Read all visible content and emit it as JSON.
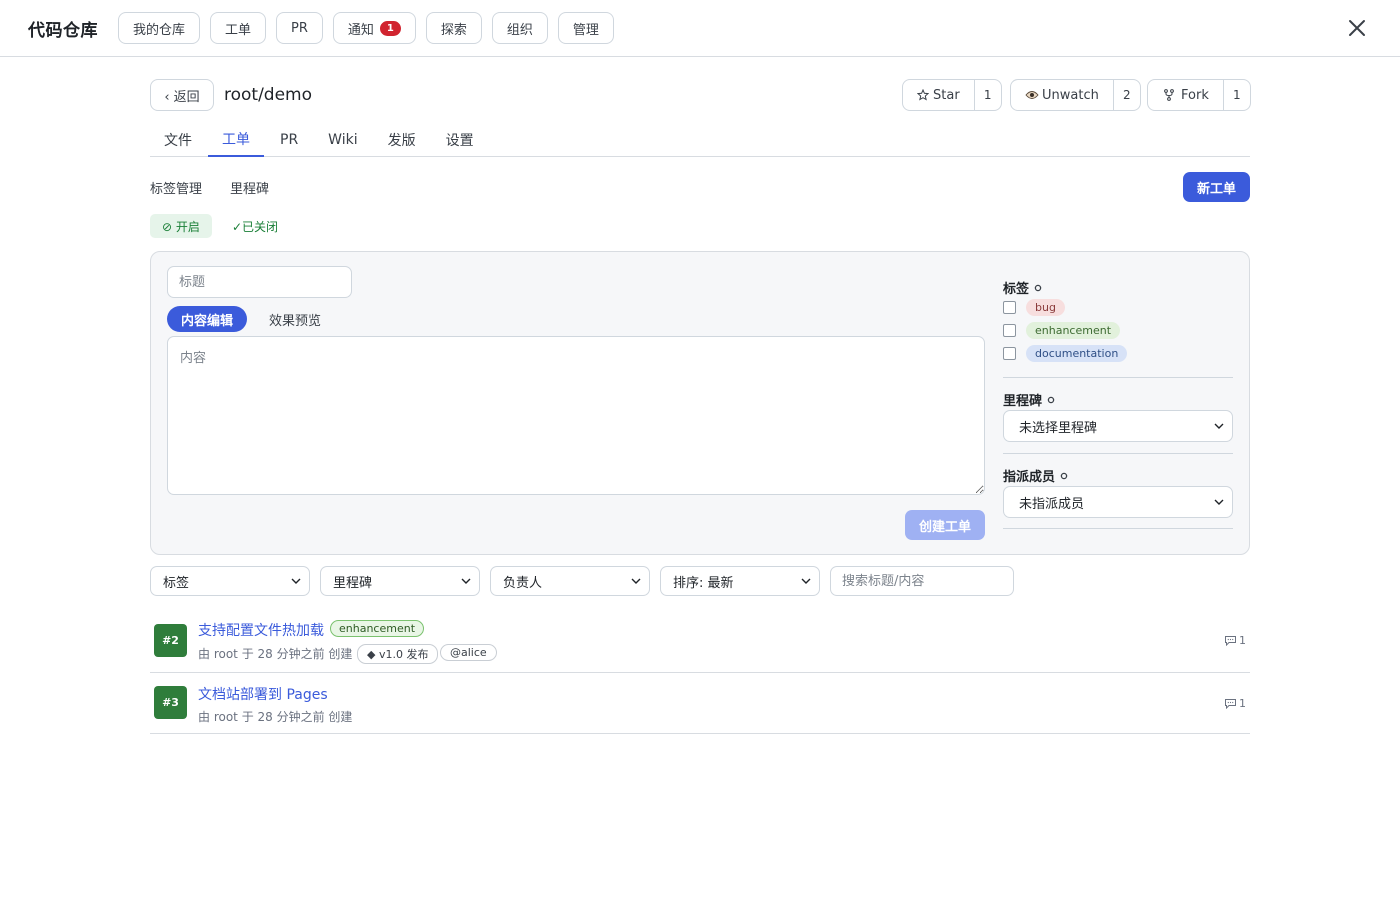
{
  "topbar": {
    "brand": "代码仓库",
    "nav": [
      {
        "label": "我的仓库"
      },
      {
        "label": "工单"
      },
      {
        "label": "PR"
      },
      {
        "label": "通知",
        "badge": "1"
      },
      {
        "label": "探索"
      },
      {
        "label": "组织"
      },
      {
        "label": "管理"
      }
    ],
    "close_icon": "close-icon"
  },
  "repo": {
    "back_label": "‹ 返回",
    "name": "root/demo",
    "star": {
      "label": "Star",
      "count": "1"
    },
    "watch": {
      "label": "Unwatch",
      "count": "2"
    },
    "fork": {
      "label": "Fork",
      "count": "1"
    }
  },
  "tabs": [
    {
      "label": "文件"
    },
    {
      "label": "工单",
      "active": true
    },
    {
      "label": "PR"
    },
    {
      "label": "Wiki"
    },
    {
      "label": "发版"
    },
    {
      "label": "设置"
    }
  ],
  "sublinks": {
    "labels": "标签管理",
    "milestones": "里程碑"
  },
  "new_issue_label": "新工单",
  "states": {
    "open": "⊘ 开启",
    "closed": "✓已关闭"
  },
  "form": {
    "title_placeholder": "标题",
    "edit_tab": "内容编辑",
    "preview_tab": "效果预览",
    "content_placeholder": "内容",
    "create_label": "创建工单",
    "labels_heading": "标签",
    "labels": [
      {
        "name": "bug",
        "bg": "#f7dede",
        "fg": "#8a3a3a"
      },
      {
        "name": "enhancement",
        "bg": "#e2f1dc",
        "fg": "#3d6b32"
      },
      {
        "name": "documentation",
        "bg": "#d7e2f7",
        "fg": "#2f4f86"
      }
    ],
    "milestone_heading": "里程碑",
    "milestone_value": "未选择里程碑",
    "assignee_heading": "指派成员",
    "assignee_value": "未指派成员"
  },
  "filters": {
    "label": "标签",
    "milestone": "里程碑",
    "assignee": "负责人",
    "sort": "排序: 最新",
    "search_placeholder": "搜索标题/内容"
  },
  "issues": [
    {
      "number": "#2",
      "title": "支持配置文件热加载",
      "label": "enhancement",
      "meta": "由 root 于 28 分钟之前 创建",
      "milestone": "◆ v1.0 发布",
      "assignee": "@alice",
      "comments": "1"
    },
    {
      "number": "#3",
      "title": "文档站部署到 Pages",
      "meta": "由 root 于 28 分钟之前 创建",
      "comments": "1"
    }
  ],
  "colors": {
    "accent": "#3b5bdb",
    "open_green": "#1a7f37",
    "issue_badge": "#2f7d3b",
    "notify_badge": "#d1242f"
  }
}
